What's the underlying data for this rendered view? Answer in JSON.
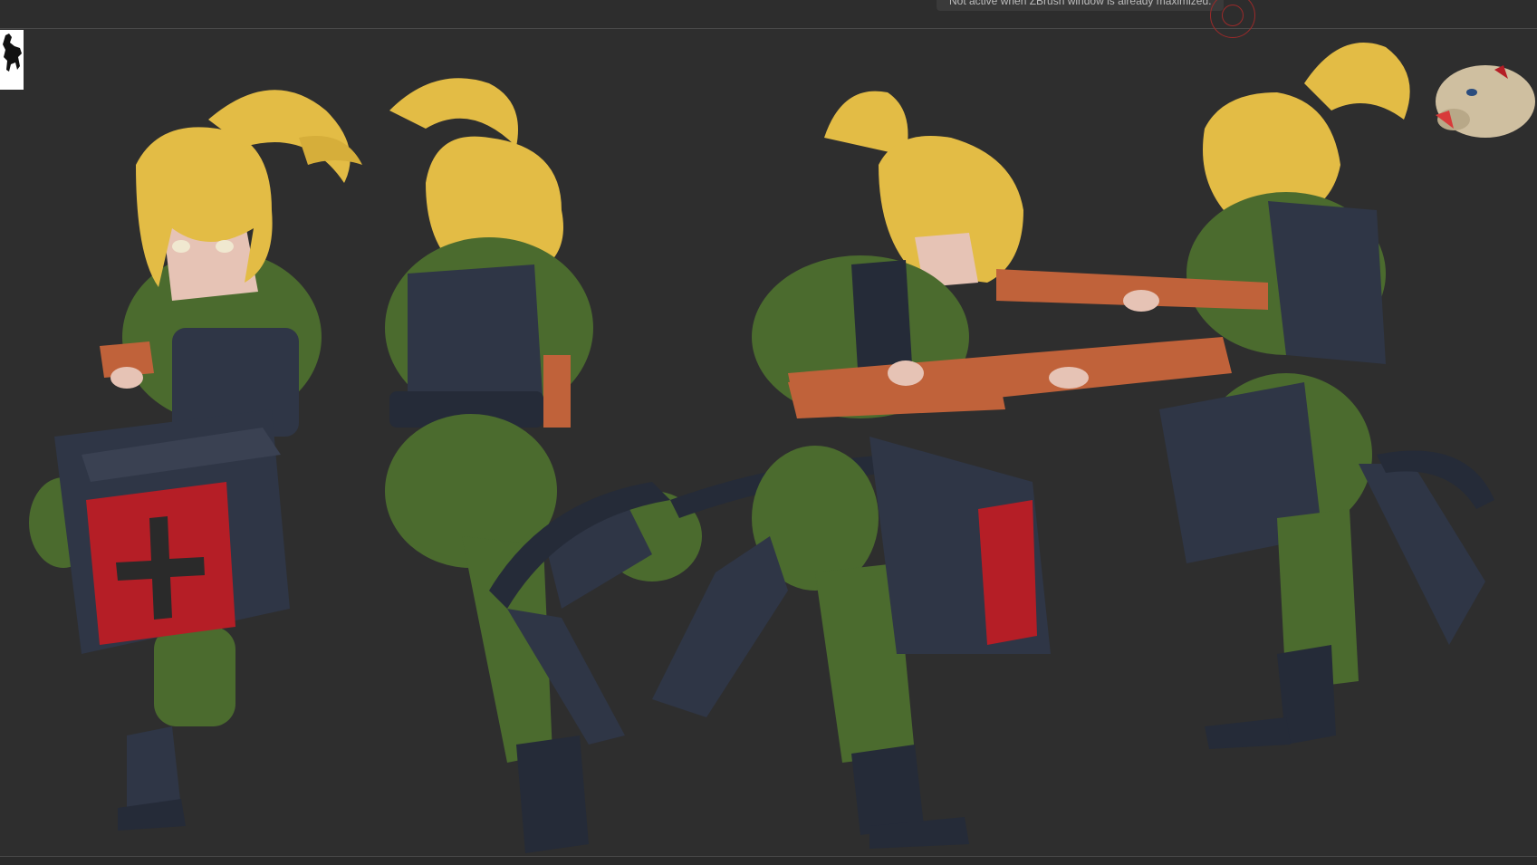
{
  "tooltip": {
    "text": "Not active when ZBrush window is already maximized."
  },
  "logo": {
    "icon": "horse-rider-silhouette-icon"
  },
  "viewport": {
    "content": "sculpt-model-turnaround",
    "colors": {
      "background": "#2e2e2e",
      "hair": "#e3bc45",
      "uniform": "#4b6b2e",
      "gear": "#2f3646",
      "crate": "#b51e26",
      "rifle": "#c0623a",
      "skin": "#e6c3b5"
    }
  }
}
